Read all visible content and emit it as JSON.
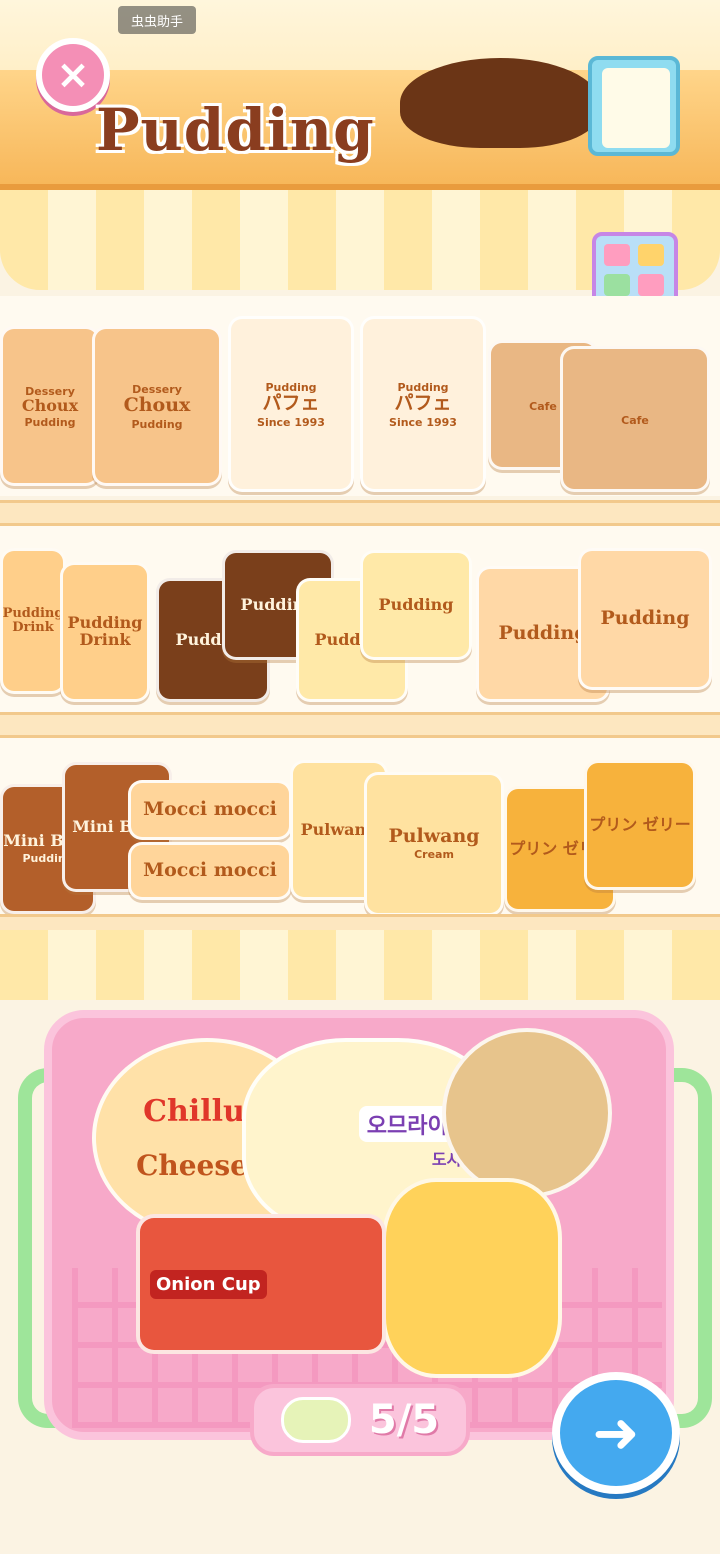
{
  "system": {
    "assistant_tag": "虫虫助手"
  },
  "header": {
    "title": "Pudding",
    "close_icon": "×"
  },
  "shelves": [
    {
      "items": [
        {
          "name": "choux-pudding-1",
          "top": "Dessery",
          "label": "Choux",
          "sub": "Pudding",
          "color": "#f7c48a"
        },
        {
          "name": "choux-pudding-2",
          "top": "Dessery",
          "label": "Choux",
          "sub": "Pudding",
          "color": "#f7c48a"
        },
        {
          "name": "parfait-cup-1",
          "top": "Pudding",
          "label": "パフェ",
          "sub": "Since 1993",
          "color": "#fff1dc"
        },
        {
          "name": "parfait-cup-2",
          "top": "Pudding",
          "label": "パフェ",
          "sub": "Since 1993",
          "color": "#fff1dc"
        },
        {
          "name": "cake-slice-1",
          "top": "Cafe",
          "label": "",
          "sub": "",
          "color": "#e9b784"
        },
        {
          "name": "cake-slice-2",
          "top": "Cafe",
          "label": "",
          "sub": "",
          "color": "#e9b784"
        }
      ]
    },
    {
      "items": [
        {
          "name": "pudding-drink-1",
          "top": "",
          "label": "Pudding Drink",
          "sub": "",
          "color": "#ffcf8a"
        },
        {
          "name": "pudding-drink-2",
          "top": "",
          "label": "Pudding Drink",
          "sub": "",
          "color": "#ffcf8a"
        },
        {
          "name": "choco-pudding-jar-1",
          "top": "",
          "label": "Pudding",
          "sub": "",
          "color": "#7a3f1b"
        },
        {
          "name": "choco-pudding-jar-2",
          "top": "",
          "label": "Pudding",
          "sub": "",
          "color": "#7a3f1b"
        },
        {
          "name": "milk-pudding-jar-1",
          "top": "",
          "label": "Pudding",
          "sub": "",
          "color": "#ffe9a8"
        },
        {
          "name": "milk-pudding-jar-2",
          "top": "",
          "label": "Pudding",
          "sub": "",
          "color": "#ffe9a8"
        },
        {
          "name": "pudding-sandwich-1",
          "top": "",
          "label": "Pudding",
          "sub": "",
          "color": "#ffd8a6"
        },
        {
          "name": "pudding-sandwich-2",
          "top": "",
          "label": "Pudding",
          "sub": "",
          "color": "#ffd8a6"
        }
      ]
    },
    {
      "items": [
        {
          "name": "mini-bear-1",
          "top": "",
          "label": "Mini Bear",
          "sub": "Pudding",
          "color": "#b35f2a"
        },
        {
          "name": "mini-bear-2",
          "top": "",
          "label": "Mini Bear",
          "sub": "",
          "color": "#b35f2a"
        },
        {
          "name": "mocci-mocci-1",
          "top": "",
          "label": "Mocci mocci",
          "sub": "",
          "color": "#ffd59a"
        },
        {
          "name": "mocci-mocci-2",
          "top": "",
          "label": "Mocci mocci",
          "sub": "",
          "color": "#ffd59a"
        },
        {
          "name": "pulwang-1",
          "top": "",
          "label": "Pulwang",
          "sub": "",
          "color": "#ffe2a0"
        },
        {
          "name": "pulwang-2",
          "top": "",
          "label": "Pulwang",
          "sub": "Cream",
          "color": "#ffe2a0"
        },
        {
          "name": "purin-jelly-1",
          "top": "",
          "label": "プリン ゼリー",
          "sub": "",
          "color": "#f7b23c"
        },
        {
          "name": "purin-jelly-2",
          "top": "",
          "label": "プリン ゼリー",
          "sub": "",
          "color": "#f7b23c"
        }
      ]
    }
  ],
  "basket": {
    "items": [
      {
        "name": "chillus-cheese-snack",
        "label": "Chillu's",
        "label2": "Cheese S"
      },
      {
        "name": "omurice-bento",
        "label": "오므라이스",
        "label2": "도시락"
      },
      {
        "name": "onion-cup-snack",
        "label": "Onion Cup",
        "label2": ""
      },
      {
        "name": "iced-drink-cup",
        "label": "",
        "label2": ""
      },
      {
        "name": "lidded-cup",
        "label": "",
        "label2": ""
      }
    ],
    "count": "5/5"
  },
  "colors": {
    "brand": "#f48fb6",
    "next": "#44a9ef",
    "basket": "#f7a9c9"
  }
}
